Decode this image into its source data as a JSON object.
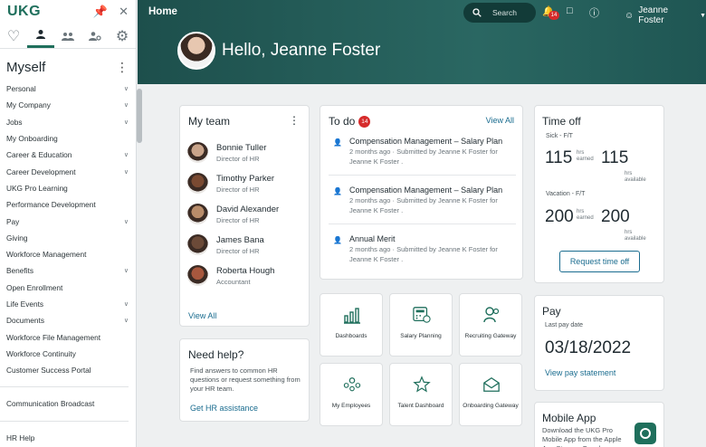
{
  "sidebar": {
    "logo": "UKG",
    "section_title": "Myself",
    "items": [
      {
        "label": "Personal",
        "chevron": true
      },
      {
        "label": "My Company",
        "chevron": true
      },
      {
        "label": "Jobs",
        "chevron": true
      },
      {
        "label": "My Onboarding",
        "chevron": false
      },
      {
        "label": "Career & Education",
        "chevron": true
      },
      {
        "label": "Career Development",
        "chevron": true
      },
      {
        "label": "UKG Pro Learning",
        "chevron": false
      },
      {
        "label": "Performance Development",
        "chevron": false
      },
      {
        "label": "Pay",
        "chevron": true
      },
      {
        "label": "Giving",
        "chevron": false
      },
      {
        "label": "Workforce Management",
        "chevron": false
      },
      {
        "label": "Benefits",
        "chevron": true
      },
      {
        "label": "Open Enrollment",
        "chevron": false
      },
      {
        "label": "Life Events",
        "chevron": true
      },
      {
        "label": "Documents",
        "chevron": true
      },
      {
        "label": "Workforce File Management",
        "chevron": false
      },
      {
        "label": "Workforce Continuity",
        "chevron": false
      },
      {
        "label": "Customer Success Portal",
        "chevron": false
      }
    ],
    "items_after_sep": [
      "Communication Broadcast"
    ],
    "items_after_sep2": [
      "HR Help"
    ]
  },
  "header": {
    "title": "Home",
    "search_label": "Search",
    "notification_count": "14",
    "user_name": "Jeanne Foster",
    "greeting": "Hello, Jeanne Foster"
  },
  "team": {
    "title": "My team",
    "view_all": "View All",
    "members": [
      {
        "name": "Bonnie Tuller",
        "role": "Director of HR",
        "color": "#c9a48a"
      },
      {
        "name": "Timothy Parker",
        "role": "Director of HR",
        "color": "#7a4a32"
      },
      {
        "name": "David Alexander",
        "role": "Director of HR",
        "color": "#b88c6a"
      },
      {
        "name": "James Bana",
        "role": "Director of HR",
        "color": "#6b4a38"
      },
      {
        "name": "Roberta Hough",
        "role": "Accountant",
        "color": "#a8583e"
      }
    ]
  },
  "help": {
    "title": "Need help?",
    "description": "Find answers to common HR questions or request something from your HR team.",
    "link": "Get HR assistance"
  },
  "todo": {
    "title": "To do",
    "count": "14",
    "view_all": "View All",
    "tasks": [
      {
        "title": "Compensation Management – Salary Plan",
        "meta": "2 months ago · Submitted by Jeanne K Foster for Jeanne K Foster ."
      },
      {
        "title": "Compensation Management – Salary Plan",
        "meta": "2 months ago · Submitted by Jeanne K Foster for Jeanne K Foster ."
      },
      {
        "title": "Annual Merit",
        "meta": "2 months ago · Submitted by Jeanne K Foster for Jeanne K Foster ."
      }
    ]
  },
  "tiles": [
    {
      "label": "Dashboards",
      "icon": "bar-chart-icon"
    },
    {
      "label": "Salary Planning",
      "icon": "calculator-icon"
    },
    {
      "label": "Recruiting Gateway",
      "icon": "recruiting-icon"
    },
    {
      "label": "My Employees",
      "icon": "employees-icon"
    },
    {
      "label": "Talent Dashboard",
      "icon": "star-person-icon"
    },
    {
      "label": "Onboarding Gateway",
      "icon": "envelope-icon"
    }
  ],
  "time_off": {
    "title": "Time off",
    "sick_label": "Sick - F/T",
    "sick_earned": "115",
    "sick_available": "115",
    "vacation_label": "Vacation - F/T",
    "vac_earned": "200",
    "vac_available": "200",
    "earned_unit_1": "hrs",
    "earned_unit_2": "earned",
    "avail_unit_1": "hrs",
    "avail_unit_2": "available",
    "button": "Request time off"
  },
  "pay": {
    "title": "Pay",
    "last_pay_label": "Last pay date",
    "last_pay_date": "03/18/2022",
    "link": "View pay statement"
  },
  "mobile": {
    "title": "Mobile App",
    "description": "Download the UKG Pro Mobile App from the Apple App Store or Google..."
  },
  "colors": {
    "brand": "#1f6f5c",
    "header": "#2a6762",
    "link": "#1a6c8f",
    "badge": "#d62b2b"
  }
}
